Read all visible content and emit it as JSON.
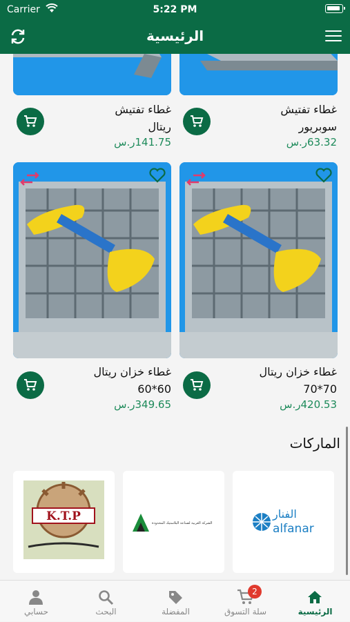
{
  "status_bar": {
    "carrier": "Carrier",
    "time": "5:22 PM"
  },
  "header": {
    "title": "الرئيسية"
  },
  "products": [
    {
      "name_line1": "غطاء تفتيش",
      "name_line2": "سوبريور",
      "price": "63.32ر.س"
    },
    {
      "name_line1": "غطاء تفتيش",
      "name_line2": "ريتال",
      "price": "141.75ر.س"
    },
    {
      "name_line1": "غطاء خزان ريتال",
      "name_line2": "70*70",
      "price": "420.53ر.س"
    },
    {
      "name_line1": "غطاء خزان ريتال",
      "name_line2": "60*60",
      "price": "349.65ر.س"
    }
  ],
  "brands": {
    "title": "الماركات",
    "items": [
      {
        "name": "alfanar",
        "name_ar": "الفنار"
      },
      {
        "name": "الشركة العربية لصناعة البلاستيك المحدودة"
      },
      {
        "name": "K.T.P"
      }
    ]
  },
  "tabbar": {
    "items": [
      {
        "label": "الرئيسية",
        "icon": "home-icon",
        "active": true
      },
      {
        "label": "سلة التسوق",
        "icon": "cart-icon",
        "badge": "2"
      },
      {
        "label": "المفضلة",
        "icon": "tag-icon"
      },
      {
        "label": "البحث",
        "icon": "search-icon"
      },
      {
        "label": "حسابي",
        "icon": "person-icon"
      }
    ]
  },
  "colors": {
    "brand": "#0b6b45",
    "price": "#1d8a5a",
    "badge": "#e03a2e",
    "image_bg": "#2196e8"
  }
}
